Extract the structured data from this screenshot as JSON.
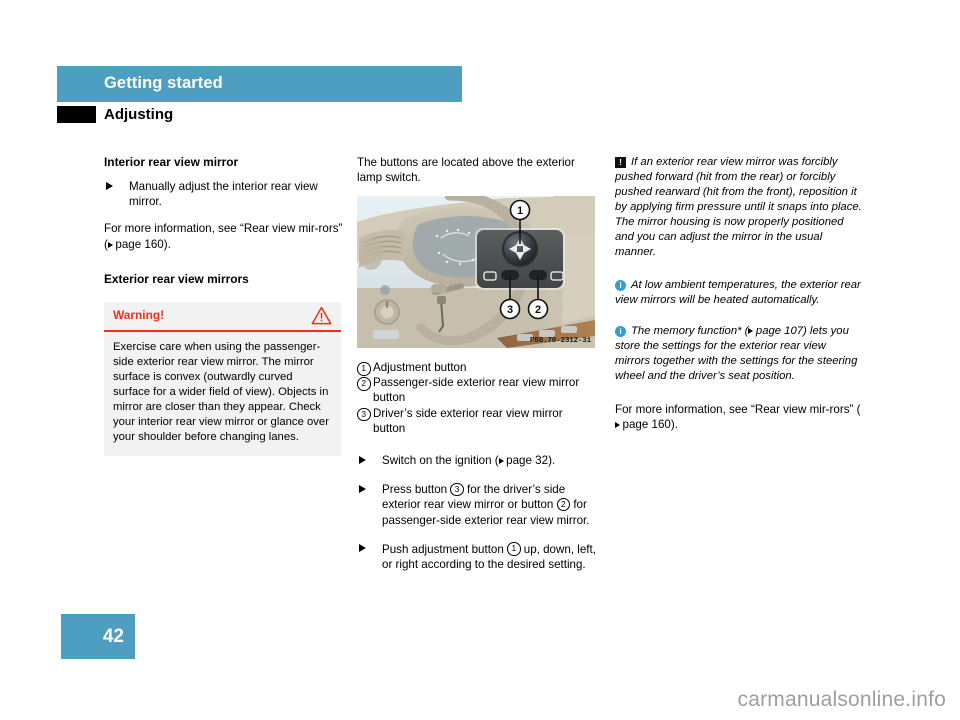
{
  "header": {
    "chapter": "Getting started",
    "section": "Adjusting"
  },
  "left_column": {
    "heading_1": "Interior rear view mirror",
    "bullet_1": "Manually adjust the interior rear view mirror.",
    "paragraph_1_a": "For more information, see “Rear view mir-rors” (",
    "paragraph_1_xref": "page 160",
    "paragraph_1_b": ").",
    "heading_2": "Exterior rear view mirrors",
    "warning": {
      "title": "Warning!",
      "icon": "warning-triangle-icon",
      "body": "Exercise care when using the passenger-side exterior rear view mirror. The mirror surface is convex (outwardly curved surface for a wider field of view). Objects in mirror are closer than they appear. Check your interior rear view mirror or glance over your shoulder before changing lanes."
    }
  },
  "middle_column": {
    "intro": "The buttons are located above the exterior lamp switch.",
    "figure": {
      "name": "dashboard-mirror-controls-photo",
      "code": "P88.70-2312-31",
      "callout_labels": [
        "1",
        "2",
        "3"
      ]
    },
    "callouts": [
      {
        "num": "1",
        "text": "Adjustment button"
      },
      {
        "num": "2",
        "text": "Passenger-side exterior rear view mirror button"
      },
      {
        "num": "3",
        "text": "Driver’s side exterior rear view mirror button"
      }
    ],
    "steps": [
      {
        "parts": [
          {
            "type": "text",
            "value": "Switch on the ignition ("
          },
          {
            "type": "xref",
            "value": "page 32"
          },
          {
            "type": "text",
            "value": ")."
          }
        ]
      },
      {
        "parts": [
          {
            "type": "text",
            "value": "Press button "
          },
          {
            "type": "circle",
            "value": "3"
          },
          {
            "type": "text",
            "value": " for the driver’s side exterior rear view mirror or button "
          },
          {
            "type": "circle",
            "value": "2"
          },
          {
            "type": "text",
            "value": " for passenger-side exterior rear view mirror."
          }
        ]
      },
      {
        "parts": [
          {
            "type": "text",
            "value": "Push adjustment button "
          },
          {
            "type": "circle",
            "value": "1"
          },
          {
            "type": "text",
            "value": " up, down, left, or right according to the desired setting."
          }
        ]
      }
    ]
  },
  "right_column": {
    "notes": [
      {
        "icon": "exclamation-box-icon",
        "icon_glyph": "!",
        "text": "If an exterior rear view mirror was forcibly pushed forward (hit from the rear) or forcibly pushed rearward (hit from the front), reposition it by applying firm pressure until it snaps into place. The mirror housing is now properly positioned and you can adjust the mirror in the usual manner."
      },
      {
        "icon": "info-circle-icon",
        "icon_glyph": "i",
        "text": "At low ambient temperatures, the exterior rear view mirrors will be heated automatically."
      },
      {
        "icon": "info-circle-icon",
        "icon_glyph": "i",
        "text_a": "The memory function* (",
        "xref": "page 107",
        "text_b": ") lets you store the settings for the exterior rear view mirrors together with the settings for the steering wheel and the driver’s seat position."
      }
    ],
    "closing_a": "For more information, see “Rear view mir-rors” (",
    "closing_xref": "page 160",
    "closing_b": ")."
  },
  "footer": {
    "page_number": "42",
    "watermark": "carmanualsonline.info"
  },
  "colors": {
    "accent_blue": "#4d9ec0",
    "warning_red": "#f0301c",
    "warning_bg": "#f2f2f2",
    "info_blue": "#2e9fd4"
  }
}
